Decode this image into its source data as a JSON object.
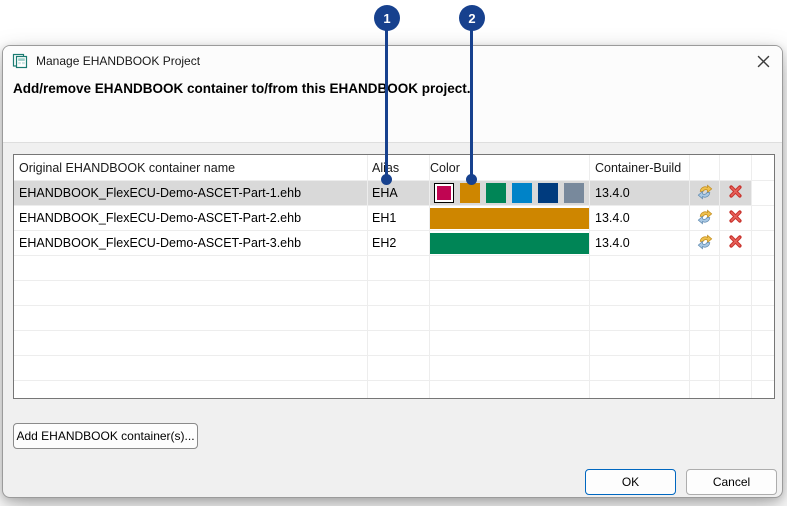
{
  "annotation": {
    "badge1": "1",
    "badge2": "2",
    "color": "#17418E"
  },
  "window": {
    "title": "Manage EHANDBOOK Project",
    "description": "Add/remove EHANDBOOK container to/from this EHANDBOOK project."
  },
  "table": {
    "headers": {
      "name": "Original EHANDBOOK container name",
      "alias": "Alias",
      "color": "Color",
      "build": "Container-Build"
    },
    "selected_row_bg": "#D9D9D9",
    "rows": [
      {
        "name": "EHANDBOOK_FlexECU-Demo-ASCET-Part-1.ehb",
        "alias": "EHA",
        "build": "13.4.0",
        "palette": [
          "#C00552",
          "#CE8600",
          "#008556",
          "#0083C8",
          "#003B7E",
          "#78899C"
        ],
        "selected_color": "#C00552"
      },
      {
        "name": "EHANDBOOK_FlexECU-Demo-ASCET-Part-2.ehb",
        "alias": "EH1",
        "build": "13.4.0",
        "color": "#CE8600"
      },
      {
        "name": "EHANDBOOK_FlexECU-Demo-ASCET-Part-3.ehb",
        "alias": "EH2",
        "build": "13.4.0",
        "color": "#008556"
      }
    ]
  },
  "buttons": {
    "add": "Add EHANDBOOK container(s)...",
    "ok": "OK",
    "cancel": "Cancel"
  },
  "icons": {
    "app": "ehandbook-app-icon",
    "close": "close-icon",
    "sync": "sync-refresh-icon",
    "delete": "delete-x-icon"
  }
}
